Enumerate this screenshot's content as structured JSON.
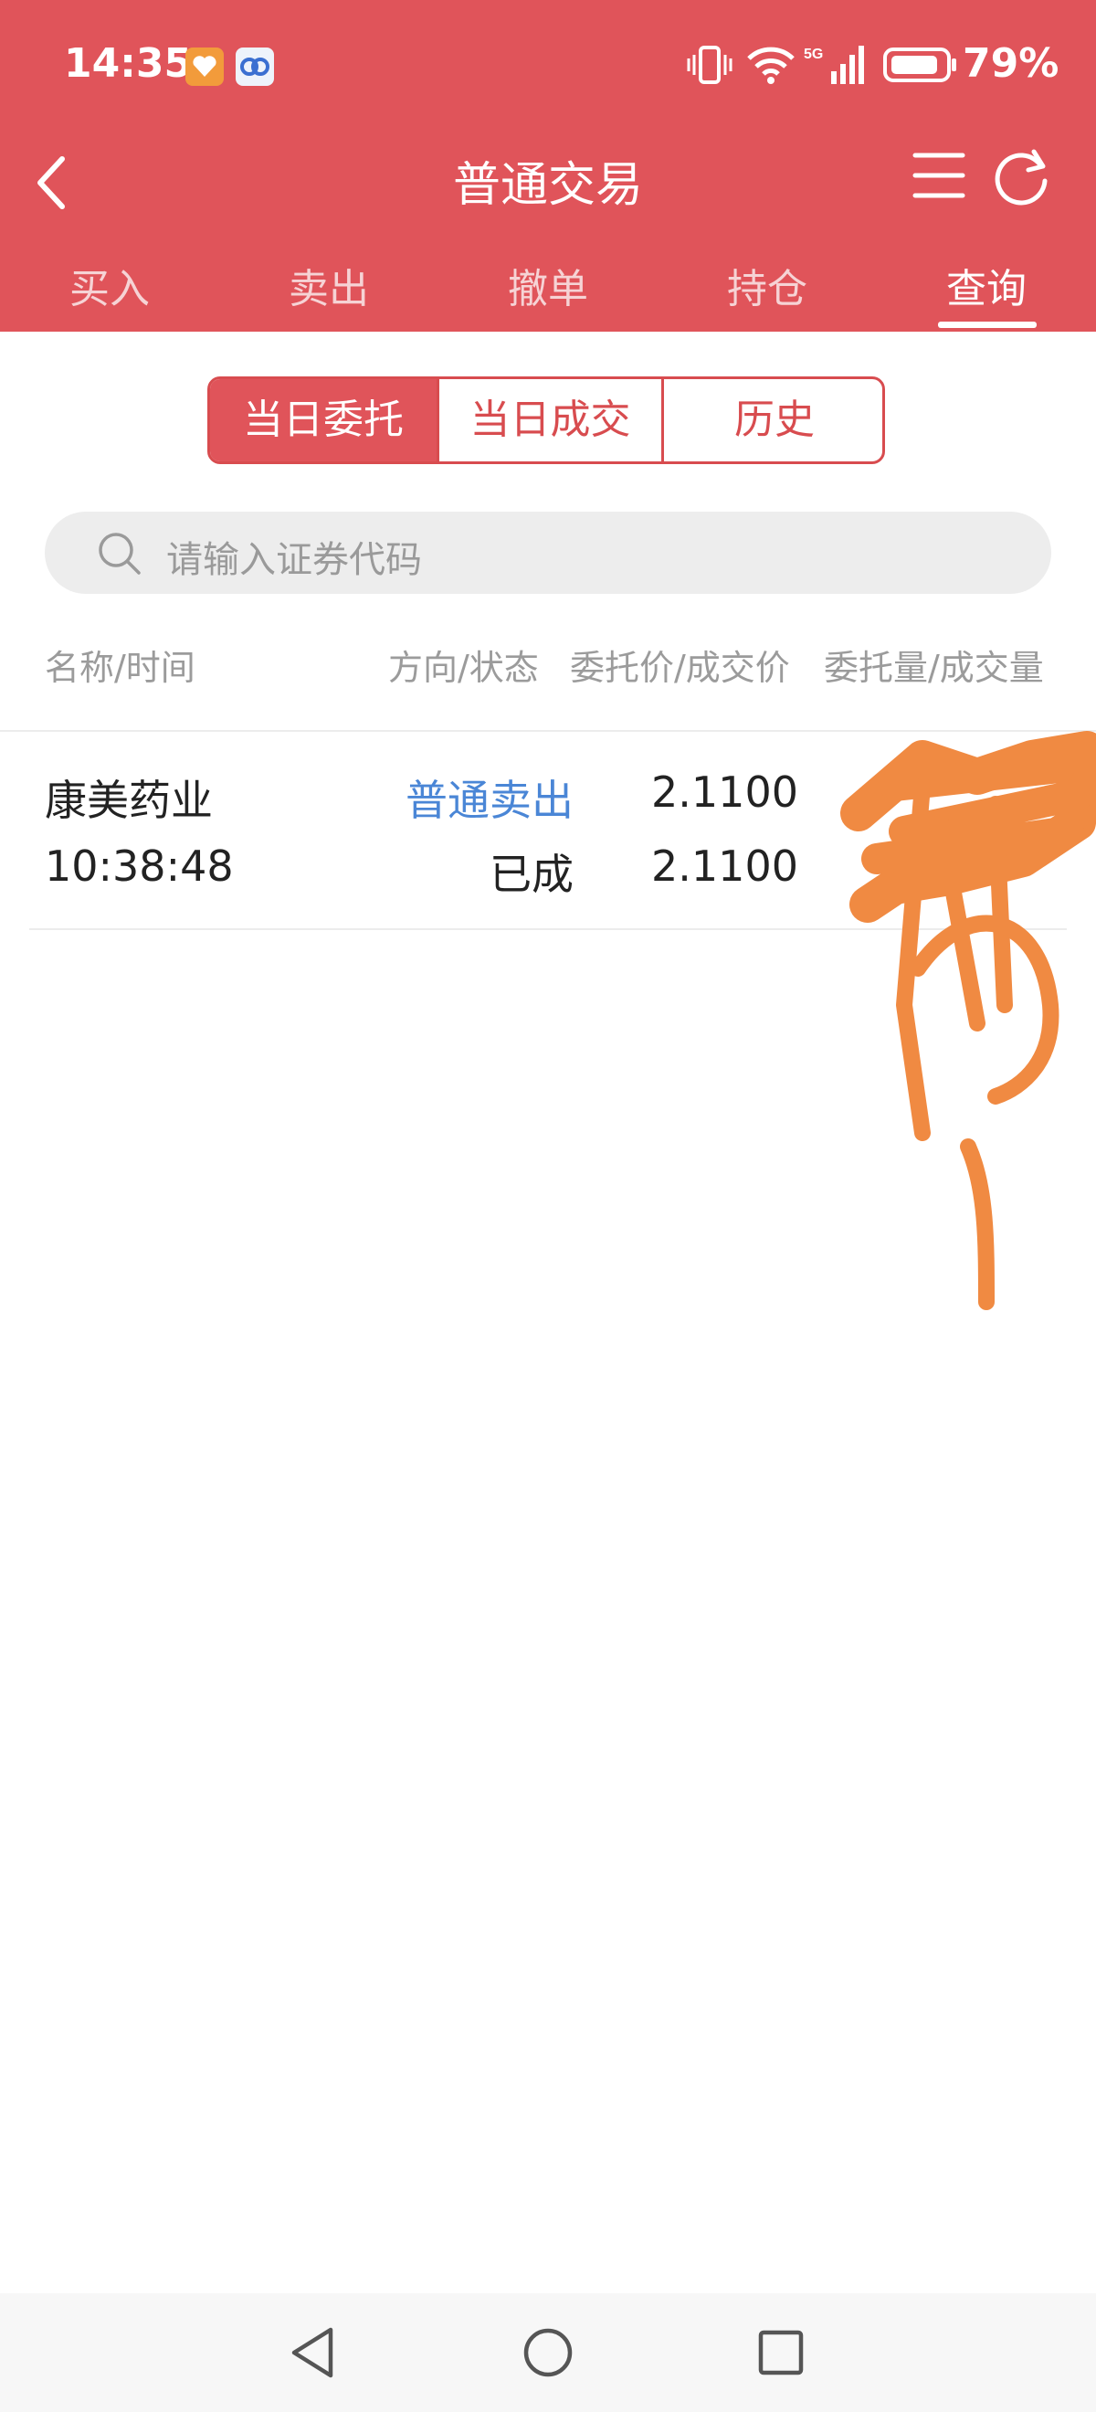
{
  "status_bar": {
    "time": "14:35",
    "battery_percent": "79%",
    "network_label": "5G",
    "icons": [
      "app-notification-icon",
      "app-notification-icon-2",
      "vibrate-icon",
      "wifi-icon",
      "signal-icon",
      "battery-icon"
    ]
  },
  "header": {
    "title": "普通交易",
    "back_icon": "chevron-left-icon",
    "menu_icon": "hamburger-menu-icon",
    "refresh_icon": "refresh-icon"
  },
  "tabs": [
    {
      "label": "买入",
      "active": false
    },
    {
      "label": "卖出",
      "active": false
    },
    {
      "label": "撤单",
      "active": false
    },
    {
      "label": "持仓",
      "active": false
    },
    {
      "label": "查询",
      "active": true
    }
  ],
  "segments": [
    {
      "label": "当日委托",
      "active": true
    },
    {
      "label": "当日成交",
      "active": false
    },
    {
      "label": "历史",
      "active": false
    }
  ],
  "search": {
    "placeholder": "请输入证券代码",
    "icon": "search-icon"
  },
  "columns": {
    "name_time": "名称/时间",
    "direction_status": "方向/状态",
    "price": "委托价/成交价",
    "quantity": "委托量/成交量"
  },
  "orders": [
    {
      "name": "康美药业",
      "time": "10:38:48",
      "direction": "普通卖出",
      "status": "已成",
      "order_price": "2.1100",
      "deal_price": "2.1100"
    }
  ],
  "colors": {
    "header_red": "#e0545a",
    "segment_red": "#d84c4f",
    "sell_blue": "#4a86d6",
    "scribble_orange": "#f08a42"
  },
  "bottom_nav": [
    "back-triangle-icon",
    "home-circle-icon",
    "recents-square-icon"
  ]
}
